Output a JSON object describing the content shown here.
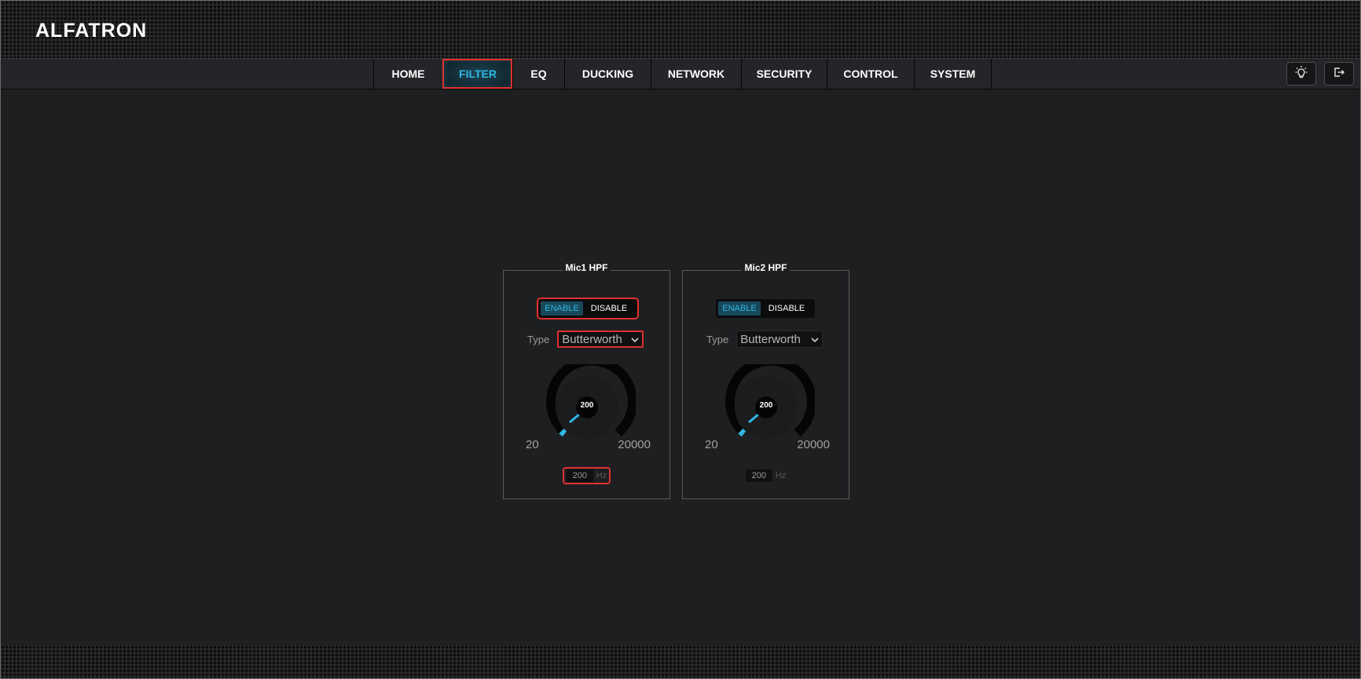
{
  "app": {
    "logo": "ALFATRON"
  },
  "nav": {
    "tabs": [
      {
        "label": "HOME",
        "active": false
      },
      {
        "label": "FILTER",
        "active": true
      },
      {
        "label": "EQ",
        "active": false
      },
      {
        "label": "DUCKING",
        "active": false
      },
      {
        "label": "NETWORK",
        "active": false
      },
      {
        "label": "SECURITY",
        "active": false
      },
      {
        "label": "CONTROL",
        "active": false
      },
      {
        "label": "SYSTEM",
        "active": false
      }
    ],
    "icons": [
      "lightbulb-icon",
      "logout-icon"
    ]
  },
  "panels": [
    {
      "title": "Mic1 HPF",
      "enable_label": "ENABLE",
      "disable_label": "DISABLE",
      "enabled": true,
      "type_label": "Type",
      "type_value": "Butterworth",
      "knob_value": "200",
      "range_min": "20",
      "range_max": "20000",
      "freq_value": "200",
      "freq_unit": "Hz"
    },
    {
      "title": "Mic2 HPF",
      "enable_label": "ENABLE",
      "disable_label": "DISABLE",
      "enabled": true,
      "type_label": "Type",
      "type_value": "Butterworth",
      "knob_value": "200",
      "range_min": "20",
      "range_max": "20000",
      "freq_value": "200",
      "freq_unit": "Hz"
    }
  ],
  "colors": {
    "accent": "#2fb7e6",
    "highlight_outline": "#e0312f",
    "background": "#1e1f21"
  }
}
